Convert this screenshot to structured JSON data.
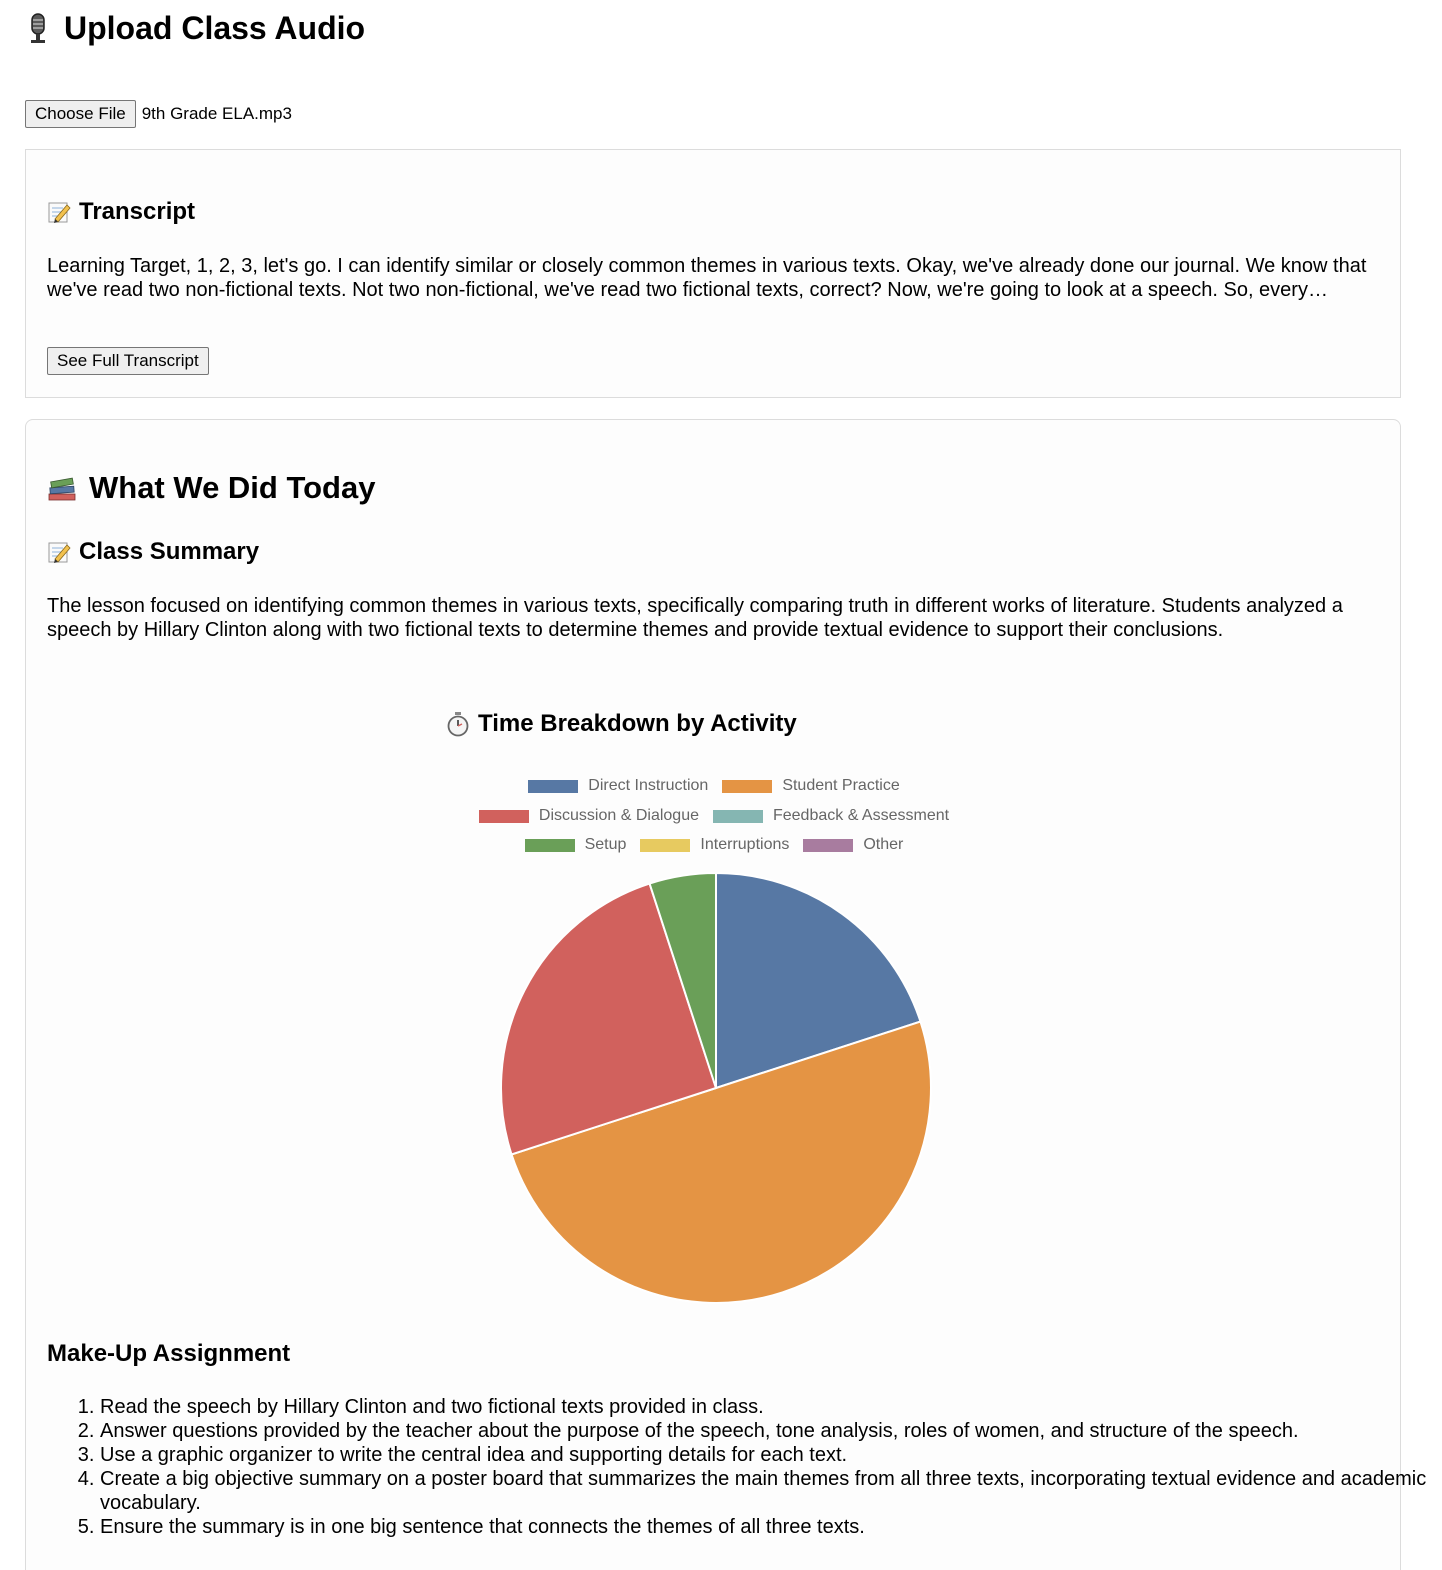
{
  "header": {
    "title": "Upload Class Audio",
    "icon": "microphone-icon"
  },
  "file_input": {
    "button_label": "Choose File",
    "file_name": "9th Grade ELA.mp3"
  },
  "transcript": {
    "title": "Transcript",
    "icon": "memo-icon",
    "text": "Learning Target, 1, 2, 3, let's go. I can identify similar or closely common themes in various texts. Okay, we've already done our journal. We know that we've read two non-fictional texts. Not two non-fictional, we've read two fictional texts, correct? Now, we're going to look at a speech. So, every…",
    "button_label": "See Full Transcript"
  },
  "today": {
    "title": "What We Did Today",
    "icon": "books-icon",
    "summary_title": "Class Summary",
    "summary_icon": "memo-icon",
    "summary_text": "The lesson focused on identifying common themes in various texts, specifically comparing truth in different works of literature. Students analyzed a speech by Hillary Clinton along with two fictional texts to determine themes and provide textual evidence to support their conclusions.",
    "chart_title": "Time Breakdown by Activity",
    "chart_icon": "stopwatch-icon",
    "makeup_title": "Make-Up Assignment",
    "makeup_items": [
      "Read the speech by Hillary Clinton and two fictional texts provided in class.",
      "Answer questions provided by the teacher about the purpose of the speech, tone analysis, roles of women, and structure of the speech.",
      "Use a graphic organizer to write the central idea and supporting details for each text.",
      "Create a big objective summary on a poster board that summarizes the main themes from all three texts, incorporating textual evidence and academic vocabulary.",
      "Ensure the summary is in one big sentence that connects the themes of all three texts."
    ]
  },
  "chart_data": {
    "type": "pie",
    "title": "Time Breakdown by Activity",
    "legend_position": "top",
    "categories": [
      "Direct Instruction",
      "Student Practice",
      "Discussion & Dialogue",
      "Feedback & Assessment",
      "Setup",
      "Interruptions",
      "Other"
    ],
    "values": [
      20,
      50,
      25,
      0,
      5,
      0,
      0
    ],
    "colors": [
      "#5778a4",
      "#e49444",
      "#d1615d",
      "#85b6b2",
      "#6a9f58",
      "#e7ca60",
      "#a87c9f"
    ]
  }
}
